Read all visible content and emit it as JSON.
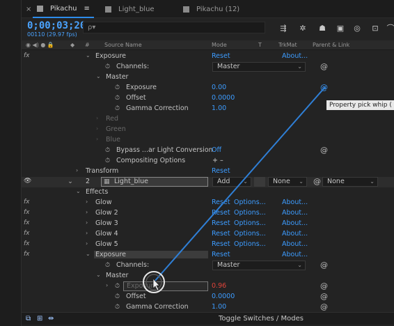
{
  "tabs": [
    {
      "label": "Pikachu",
      "active": true
    },
    {
      "label": "Light_blue",
      "active": false
    },
    {
      "label": "Pikachu (12)",
      "active": false
    }
  ],
  "tab_close": "×",
  "tab_menu": "≡",
  "timecode": "0;00;03;20",
  "fps": "00110 (29.97 fps)",
  "search_placeholder": "ρ▾",
  "toolbar_icons": [
    "comp-flowchart-icon",
    "draft-3d-icon",
    "shy-icon",
    "frame-blend-icon",
    "motion-blur-icon",
    "graph-editor-icon"
  ],
  "columns": {
    "num": "#",
    "source": "Source Name",
    "mode": "Mode",
    "t": "T",
    "trkmat": "TrkMat",
    "parent": "Parent & Link"
  },
  "rows": {
    "exposure1": {
      "label": "Exposure",
      "reset": "Reset",
      "about": "About..."
    },
    "channels1": {
      "label": "Channels:",
      "value": "Master"
    },
    "master1": {
      "label": "Master"
    },
    "exposure1_val": {
      "label": "Exposure",
      "value": "0.00"
    },
    "offset1": {
      "label": "Offset",
      "value": "0.0000"
    },
    "gamma1": {
      "label": "Gamma Correction",
      "value": "1.00"
    },
    "red": {
      "label": "Red"
    },
    "green": {
      "label": "Green"
    },
    "blue": {
      "label": "Blue"
    },
    "bypass": {
      "label": "Bypass ...ar Light Conversion",
      "value": "Off"
    },
    "compositing": {
      "label": "Compositing Options",
      "value": "+ –"
    },
    "transform": {
      "label": "Transform",
      "reset": "Reset"
    },
    "layer2": {
      "num": "2",
      "name": "Light_blue",
      "mode": "Add",
      "trkmat": "None",
      "parent": "None"
    },
    "effects": {
      "label": "Effects"
    },
    "glows": [
      {
        "label": "Glow",
        "reset": "Reset",
        "options": "Options...",
        "about": "About..."
      },
      {
        "label": "Glow 2",
        "reset": "Reset",
        "options": "Options...",
        "about": "About..."
      },
      {
        "label": "Glow 3",
        "reset": "Reset",
        "options": "Options...",
        "about": "About..."
      },
      {
        "label": "Glow 4",
        "reset": "Reset",
        "options": "Options...",
        "about": "About..."
      },
      {
        "label": "Glow 5",
        "reset": "Reset",
        "options": "Options...",
        "about": "About..."
      }
    ],
    "exposure2": {
      "label": "Exposure",
      "reset": "Reset",
      "about": "About..."
    },
    "channels2": {
      "label": "Channels:",
      "value": "Master"
    },
    "master2": {
      "label": "Master"
    },
    "exposure2_val": {
      "label": "Exposure",
      "value": "0.96"
    },
    "offset2": {
      "label": "Offset",
      "value": "0.0000"
    },
    "gamma2": {
      "label": "Gamma Correction",
      "value": "1.00"
    }
  },
  "fx": "fx",
  "tooltip": "Property pick whip (",
  "footer": {
    "toggle": "Toggle Switches / Modes"
  },
  "colors": {
    "accent": "#2d8ceb",
    "value_blue": "#3d9cff",
    "value_red": "#e0443a",
    "pickwhip_line": "#2f7fd6"
  }
}
